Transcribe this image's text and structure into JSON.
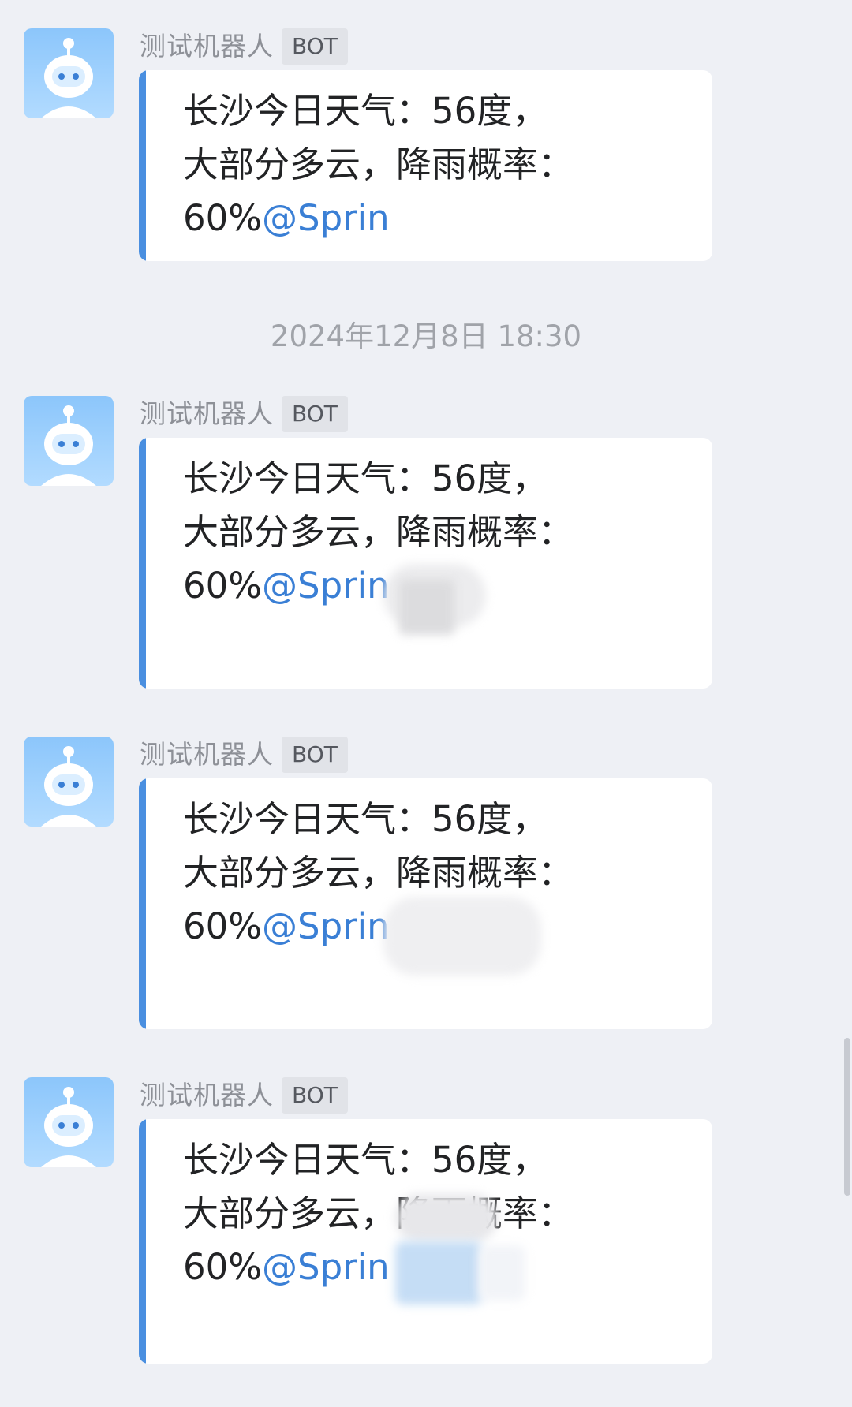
{
  "sender": {
    "name": "测试机器人",
    "badge": "BOT"
  },
  "timestamp": "2024年12月8日  18:30",
  "messages": [
    {
      "line1": "长沙今日天气：56度，",
      "line2": "大部分多云，降雨概率：",
      "line3_prefix": "60%",
      "mention": "@Sprin"
    },
    {
      "line1": "长沙今日天气：56度，",
      "line2": "大部分多云，降雨概率：",
      "line3_prefix": "60%",
      "mention": "@Sprin"
    },
    {
      "line1": "长沙今日天气：56度，",
      "line2": "大部分多云，降雨概率：",
      "line3_prefix": "60%",
      "mention": "@Sprin"
    },
    {
      "line1": "长沙今日天气：56度，",
      "line2": "大部分多云，降雨概率：",
      "line3_prefix": "60%",
      "mention": "@Sprin"
    }
  ],
  "colors": {
    "background": "#eef0f5",
    "bubble": "#ffffff",
    "accent_bar": "#4a8fe0",
    "mention": "#3a7fd5"
  },
  "icons": {
    "avatar": "robot-avatar-icon"
  }
}
